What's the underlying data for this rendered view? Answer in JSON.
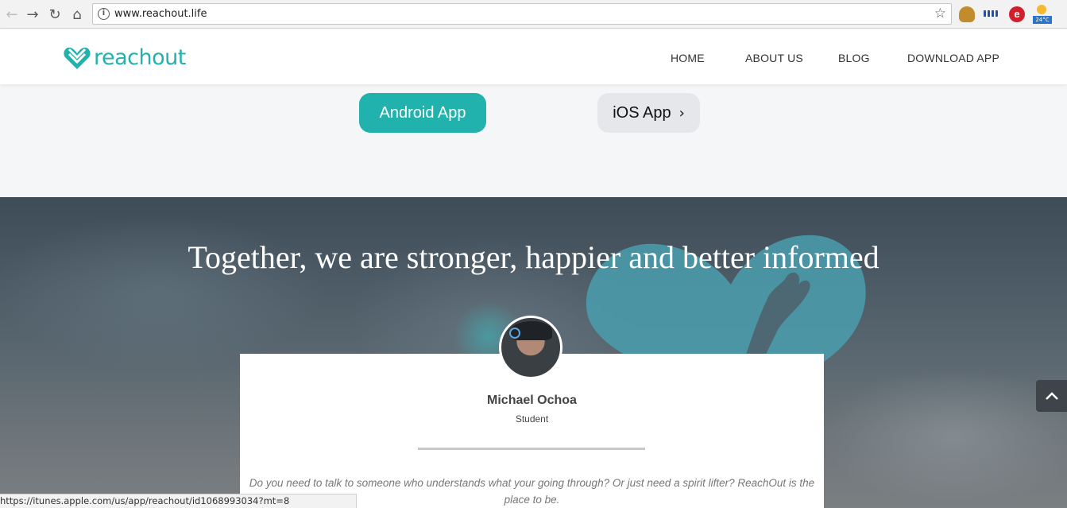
{
  "browser": {
    "url": "www.reachout.life",
    "ext_weather_temp": "24°C",
    "ext_red_letter": "e",
    "status_url": "https://itunes.apple.com/us/app/reachout/id1068993034?mt=8"
  },
  "site": {
    "logo_text": "reachout",
    "brand_color": "#22b2ad",
    "nav": [
      "HOME",
      "ABOUT US",
      "BLOG",
      "DOWNLOAD APP"
    ]
  },
  "download": {
    "android_label": "Android App",
    "ios_label": "iOS App"
  },
  "hero": {
    "title": "Together, we are stronger, happier and better informed"
  },
  "testimonial": {
    "name": "Michael Ochoa",
    "role": "Student",
    "quote": "Do you need to talk to someone who understands what your going through? Or just need a spirit lifter? ReachOut is the place to be."
  }
}
